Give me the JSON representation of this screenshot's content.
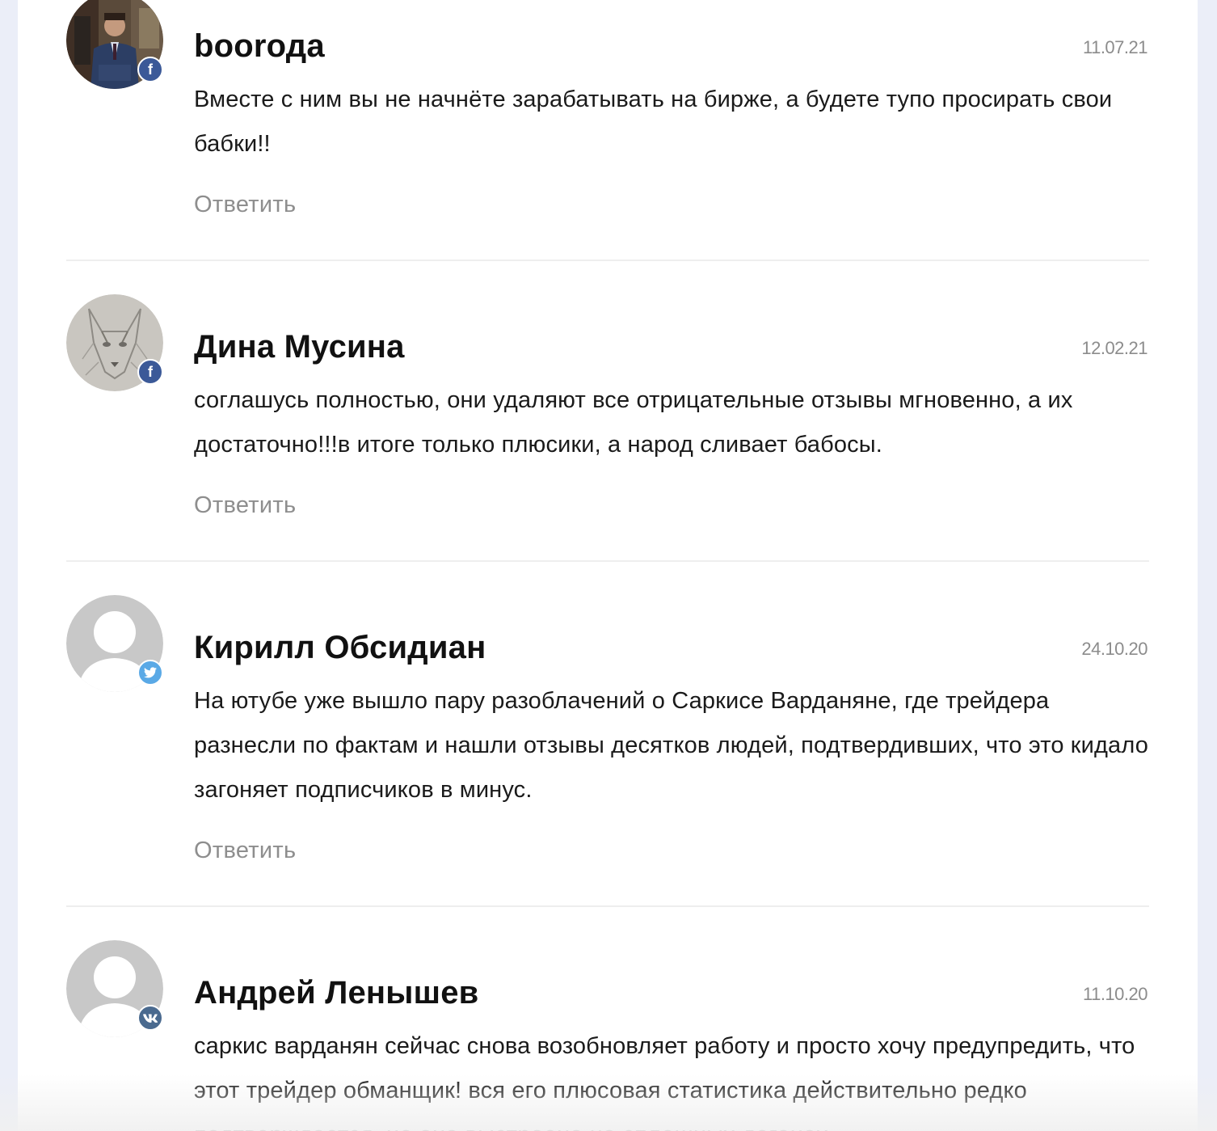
{
  "comments": [
    {
      "author": "boorода",
      "date": "11.07.21",
      "text": "Вместе с ним вы не начнёте зарабатывать на бирже, а будете тупо просирать свои бабки!!",
      "reply_label": "Ответить",
      "network": "facebook",
      "network_icon": "facebook-icon",
      "avatar": "photo-man-in-suit"
    },
    {
      "author": "Дина Мусина",
      "date": "12.02.21",
      "text": "соглашусь полностью, они удаляют все отрицательные отзывы мгновенно, а их достаточно!!!в итоге только плюсики, а народ сливает бабосы.",
      "reply_label": "Ответить",
      "network": "facebook",
      "network_icon": "facebook-icon",
      "avatar": "drawing-wolf"
    },
    {
      "author": "Кирилл Обсидиан",
      "date": "24.10.20",
      "text": "На ютубе уже вышло пару разоблачений о Саркисе Варданяне, где трейдера разнесли по фактам и нашли отзывы десятков людей, подтвердивших, что это кидало загоняет подписчиков в минус.",
      "reply_label": "Ответить",
      "network": "twitter",
      "network_icon": "twitter-icon",
      "avatar": "default-user"
    },
    {
      "author": "Андрей Ленышев",
      "date": "11.10.20",
      "text": "саркис варданян сейчас снова возобновляет работу и просто хочу предупредить, что этот трейдер обманщик! вся его плюсовая статистика действительно редко подтверждается, но она выстроена на сплошных догонах",
      "reply_label": "Ответить",
      "network": "vk",
      "network_icon": "vk-icon",
      "avatar": "default-user"
    }
  ],
  "colors": {
    "background": "#ebeef8",
    "panel": "#ffffff",
    "author": "#111111",
    "date": "#8c8c8c",
    "reply": "#8e8e8e",
    "facebook": "#3b5998",
    "twitter": "#5aa9e6",
    "vk": "#4a6a8f"
  }
}
